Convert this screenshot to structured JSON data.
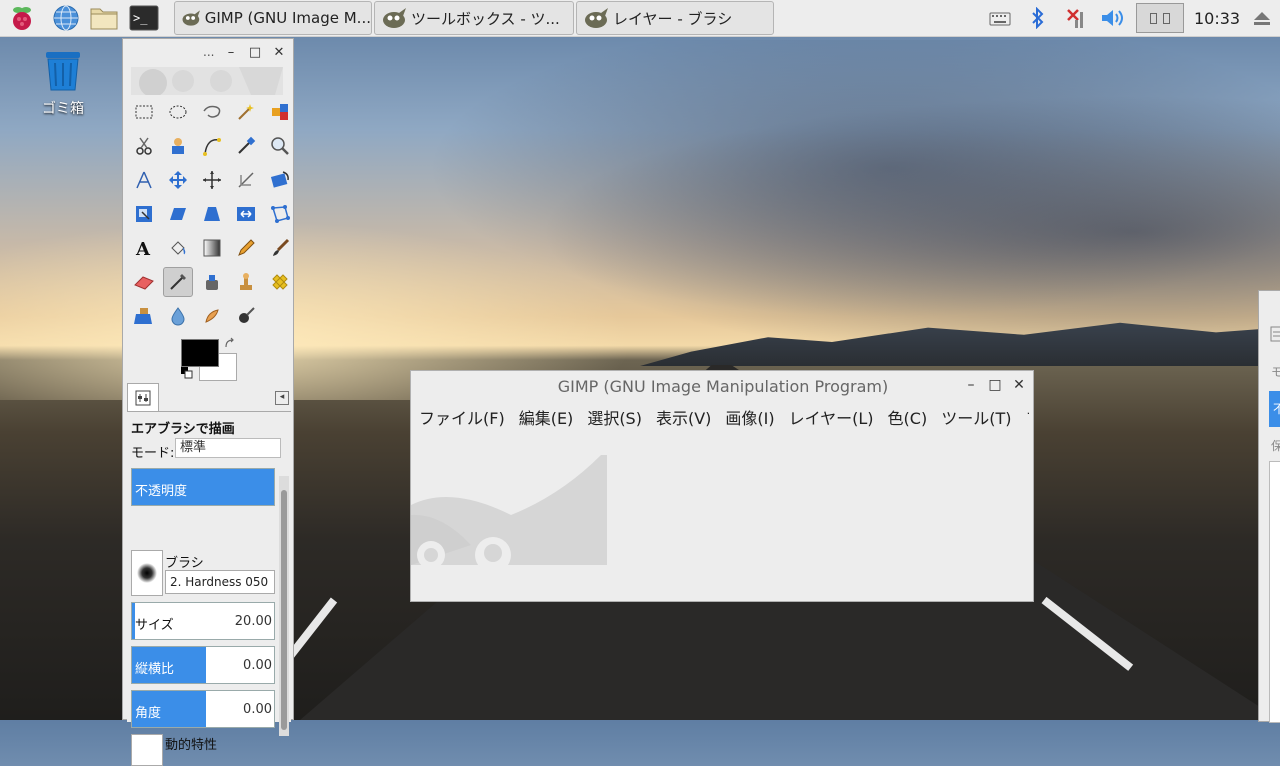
{
  "taskbar": {
    "tasks": [
      {
        "label": "GIMP (GNU Image M..."
      },
      {
        "label": "ツールボックス - ツ..."
      },
      {
        "label": "レイヤー - ブラシ"
      }
    ],
    "clock": "10:33",
    "launchers": [
      "raspberry-menu-icon",
      "web-browser-icon",
      "file-manager-icon",
      "terminal-icon"
    ],
    "tray_icons": [
      "keyboard-icon",
      "bluetooth-icon",
      "network-disconnected-icon",
      "volume-icon",
      "cpu-monitor-icon",
      "eject-icon"
    ]
  },
  "desktop": {
    "trash_label": "ゴミ箱"
  },
  "toolbox": {
    "title_dots": "...",
    "tool_options": {
      "title": "エアブラシで描画",
      "mode_label": "モード:",
      "mode_value": "標準",
      "opacity_label": "不透明度",
      "brush_label": "ブラシ",
      "brush_name": "2. Hardness 050",
      "size_label": "サイズ",
      "size_value": "20.00",
      "aspect_label": "縦横比",
      "aspect_value": "0.00",
      "angle_label": "角度",
      "angle_value": "0.00",
      "dynamics_label": "動的特性"
    }
  },
  "gimp_window": {
    "title": "GIMP (GNU Image Manipulation Program)",
    "menu": [
      "ファイル(F)",
      "編集(E)",
      "選択(S)",
      "表示(V)",
      "画像(I)",
      "レイヤー(L)",
      "色(C)",
      "ツール(T)",
      "フィ"
    ]
  },
  "right_window": {
    "label_1": "モ",
    "label_2": "不",
    "label_3": "保"
  },
  "colors": {
    "accent": "#3b8ee8",
    "window_bg": "#ededed"
  }
}
